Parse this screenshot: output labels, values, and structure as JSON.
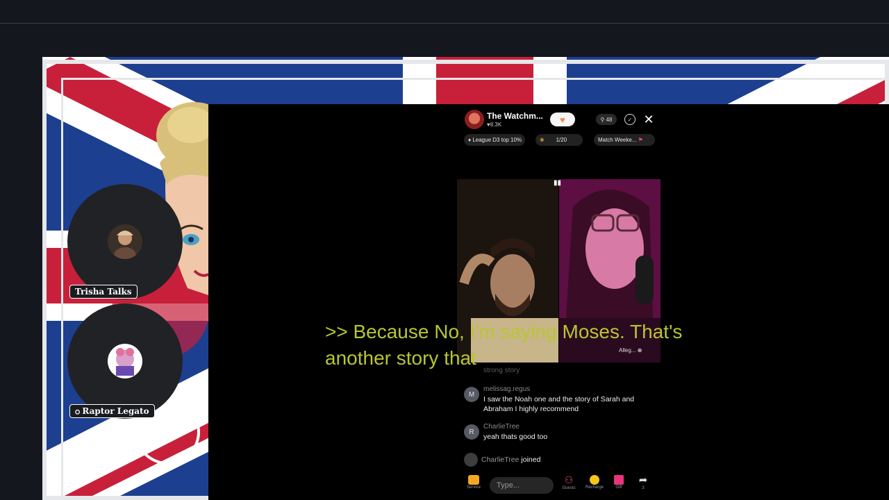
{
  "stream": {
    "host_name": "The Watchm...",
    "host_likes": "8.3K",
    "viewer_count": "48",
    "badges": {
      "league": "League D3 top 10%",
      "gift_goal": "1/20",
      "match": "Match Weeke..."
    },
    "video_label_right": "Alleg..."
  },
  "guests": [
    {
      "label": "Trisha Talks"
    },
    {
      "label": "Raptor Legato"
    }
  ],
  "caption": ">> Because No, I'm saying Moses. That's another story that",
  "chat": {
    "faded_line": "strong story",
    "messages": [
      {
        "initial": "M",
        "user": "melissag.regus",
        "text": "I saw the Noah one and the story of Sarah and Abraham I highly recommend"
      },
      {
        "initial": "R",
        "user": "CharlieTree",
        "text": "yeah thats good too"
      }
    ],
    "join_user": "CharlieTree",
    "join_text": "joined"
  },
  "bottom_bar": {
    "service": "Service",
    "input_placeholder": "Type...",
    "guests": "Guests",
    "recharge": "Recharge",
    "gift": "Gift",
    "share": "3"
  },
  "colors": {
    "flag_blue": "#1d3f8f",
    "flag_red": "#c8203a",
    "caption": "#b8c632"
  }
}
